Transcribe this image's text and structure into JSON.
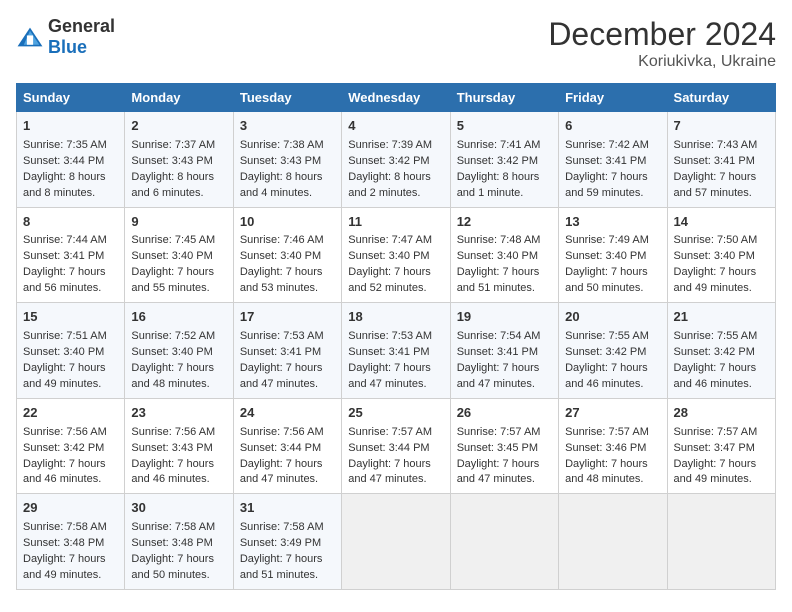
{
  "logo": {
    "general": "General",
    "blue": "Blue"
  },
  "title": "December 2024",
  "subtitle": "Koriukivka, Ukraine",
  "days_header": [
    "Sunday",
    "Monday",
    "Tuesday",
    "Wednesday",
    "Thursday",
    "Friday",
    "Saturday"
  ],
  "weeks": [
    [
      {
        "day": "1",
        "sunrise": "7:35 AM",
        "sunset": "3:44 PM",
        "daylight": "8 hours and 8 minutes."
      },
      {
        "day": "2",
        "sunrise": "7:37 AM",
        "sunset": "3:43 PM",
        "daylight": "8 hours and 6 minutes."
      },
      {
        "day": "3",
        "sunrise": "7:38 AM",
        "sunset": "3:43 PM",
        "daylight": "8 hours and 4 minutes."
      },
      {
        "day": "4",
        "sunrise": "7:39 AM",
        "sunset": "3:42 PM",
        "daylight": "8 hours and 2 minutes."
      },
      {
        "day": "5",
        "sunrise": "7:41 AM",
        "sunset": "3:42 PM",
        "daylight": "8 hours and 1 minute."
      },
      {
        "day": "6",
        "sunrise": "7:42 AM",
        "sunset": "3:41 PM",
        "daylight": "7 hours and 59 minutes."
      },
      {
        "day": "7",
        "sunrise": "7:43 AM",
        "sunset": "3:41 PM",
        "daylight": "7 hours and 57 minutes."
      }
    ],
    [
      {
        "day": "8",
        "sunrise": "7:44 AM",
        "sunset": "3:41 PM",
        "daylight": "7 hours and 56 minutes."
      },
      {
        "day": "9",
        "sunrise": "7:45 AM",
        "sunset": "3:40 PM",
        "daylight": "7 hours and 55 minutes."
      },
      {
        "day": "10",
        "sunrise": "7:46 AM",
        "sunset": "3:40 PM",
        "daylight": "7 hours and 53 minutes."
      },
      {
        "day": "11",
        "sunrise": "7:47 AM",
        "sunset": "3:40 PM",
        "daylight": "7 hours and 52 minutes."
      },
      {
        "day": "12",
        "sunrise": "7:48 AM",
        "sunset": "3:40 PM",
        "daylight": "7 hours and 51 minutes."
      },
      {
        "day": "13",
        "sunrise": "7:49 AM",
        "sunset": "3:40 PM",
        "daylight": "7 hours and 50 minutes."
      },
      {
        "day": "14",
        "sunrise": "7:50 AM",
        "sunset": "3:40 PM",
        "daylight": "7 hours and 49 minutes."
      }
    ],
    [
      {
        "day": "15",
        "sunrise": "7:51 AM",
        "sunset": "3:40 PM",
        "daylight": "7 hours and 49 minutes."
      },
      {
        "day": "16",
        "sunrise": "7:52 AM",
        "sunset": "3:40 PM",
        "daylight": "7 hours and 48 minutes."
      },
      {
        "day": "17",
        "sunrise": "7:53 AM",
        "sunset": "3:41 PM",
        "daylight": "7 hours and 47 minutes."
      },
      {
        "day": "18",
        "sunrise": "7:53 AM",
        "sunset": "3:41 PM",
        "daylight": "7 hours and 47 minutes."
      },
      {
        "day": "19",
        "sunrise": "7:54 AM",
        "sunset": "3:41 PM",
        "daylight": "7 hours and 47 minutes."
      },
      {
        "day": "20",
        "sunrise": "7:55 AM",
        "sunset": "3:42 PM",
        "daylight": "7 hours and 46 minutes."
      },
      {
        "day": "21",
        "sunrise": "7:55 AM",
        "sunset": "3:42 PM",
        "daylight": "7 hours and 46 minutes."
      }
    ],
    [
      {
        "day": "22",
        "sunrise": "7:56 AM",
        "sunset": "3:42 PM",
        "daylight": "7 hours and 46 minutes."
      },
      {
        "day": "23",
        "sunrise": "7:56 AM",
        "sunset": "3:43 PM",
        "daylight": "7 hours and 46 minutes."
      },
      {
        "day": "24",
        "sunrise": "7:56 AM",
        "sunset": "3:44 PM",
        "daylight": "7 hours and 47 minutes."
      },
      {
        "day": "25",
        "sunrise": "7:57 AM",
        "sunset": "3:44 PM",
        "daylight": "7 hours and 47 minutes."
      },
      {
        "day": "26",
        "sunrise": "7:57 AM",
        "sunset": "3:45 PM",
        "daylight": "7 hours and 47 minutes."
      },
      {
        "day": "27",
        "sunrise": "7:57 AM",
        "sunset": "3:46 PM",
        "daylight": "7 hours and 48 minutes."
      },
      {
        "day": "28",
        "sunrise": "7:57 AM",
        "sunset": "3:47 PM",
        "daylight": "7 hours and 49 minutes."
      }
    ],
    [
      {
        "day": "29",
        "sunrise": "7:58 AM",
        "sunset": "3:48 PM",
        "daylight": "7 hours and 49 minutes."
      },
      {
        "day": "30",
        "sunrise": "7:58 AM",
        "sunset": "3:48 PM",
        "daylight": "7 hours and 50 minutes."
      },
      {
        "day": "31",
        "sunrise": "7:58 AM",
        "sunset": "3:49 PM",
        "daylight": "7 hours and 51 minutes."
      },
      null,
      null,
      null,
      null
    ]
  ],
  "labels": {
    "sunrise": "Sunrise:",
    "sunset": "Sunset:",
    "daylight": "Daylight:"
  }
}
